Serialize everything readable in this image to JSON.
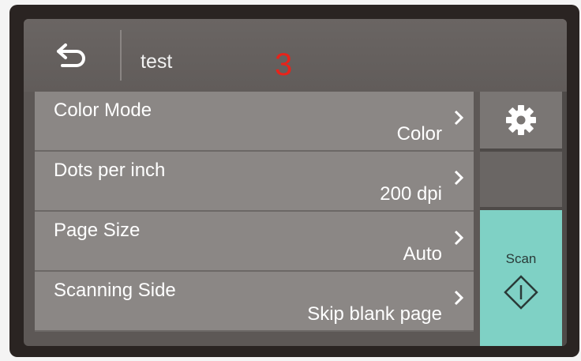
{
  "header": {
    "back_icon": "back-arrow-icon",
    "title": "test",
    "annotation": "3"
  },
  "settings": [
    {
      "label": "Color Mode",
      "value": "Color"
    },
    {
      "label": "Dots per inch",
      "value": "200 dpi"
    },
    {
      "label": "Page Size",
      "value": "Auto"
    },
    {
      "label": "Scanning Side",
      "value": "Skip blank page"
    }
  ],
  "side_panel": {
    "settings_icon": "gear-icon",
    "scan_label": "Scan",
    "scan_icon": "start-diamond-icon"
  },
  "colors": {
    "scan_accent": "#7fd1c5",
    "annotation": "#e8231a"
  }
}
